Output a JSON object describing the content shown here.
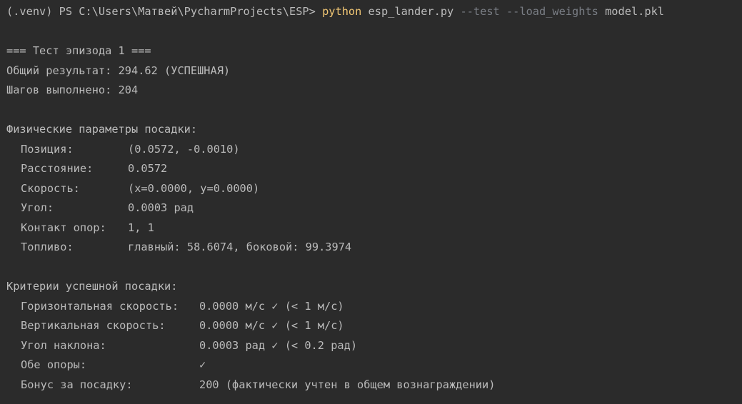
{
  "command": {
    "prompt": "(.venv) PS C:\\Users\\Матвей\\PycharmProjects\\ESP> ",
    "exe": "python",
    "script": " esp_lander.py ",
    "flags": "--test --load_weights",
    "file": " model.pkl"
  },
  "episode": {
    "header": "=== Тест эпизода 1 ===",
    "result_label": "Общий результат: ",
    "result_value": "294.62 (УСПЕШНАЯ)",
    "steps_label": "Шагов выполнено: ",
    "steps_value": "204"
  },
  "physics": {
    "title": "Физические параметры посадки:",
    "rows": [
      {
        "label": "Позиция:",
        "value": "(0.0572, -0.0010)"
      },
      {
        "label": "Расстояние:",
        "value": "0.0572"
      },
      {
        "label": "Скорость:",
        "value": "(x=0.0000, y=0.0000)"
      },
      {
        "label": "Угол:",
        "value": "0.0003 рад"
      },
      {
        "label": "Контакт опор:",
        "value": "1, 1"
      },
      {
        "label": "Топливо:",
        "value": "главный: 58.6074, боковой: 99.3974"
      }
    ]
  },
  "criteria": {
    "title": "Критерии успешной посадки:",
    "rows": [
      {
        "label": "Горизонтальная скорость:",
        "value": "0.0000 м/с ✓ (< 1 м/с)"
      },
      {
        "label": "Вертикальная скорость:",
        "value": "0.0000 м/с ✓ (< 1 м/с)"
      },
      {
        "label": "Угол наклона:",
        "value": "0.0003 рад ✓ (< 0.2 рад)"
      },
      {
        "label": "Обе опоры:",
        "value": "✓"
      },
      {
        "label": "Бонус за посадку:",
        "value": "200 (фактически учтен в общем вознаграждении)"
      }
    ]
  },
  "colors": {
    "background": "#2b2b2b",
    "text": "#bbbbbb",
    "command": "#f0c674",
    "option": "#7a7e85"
  }
}
